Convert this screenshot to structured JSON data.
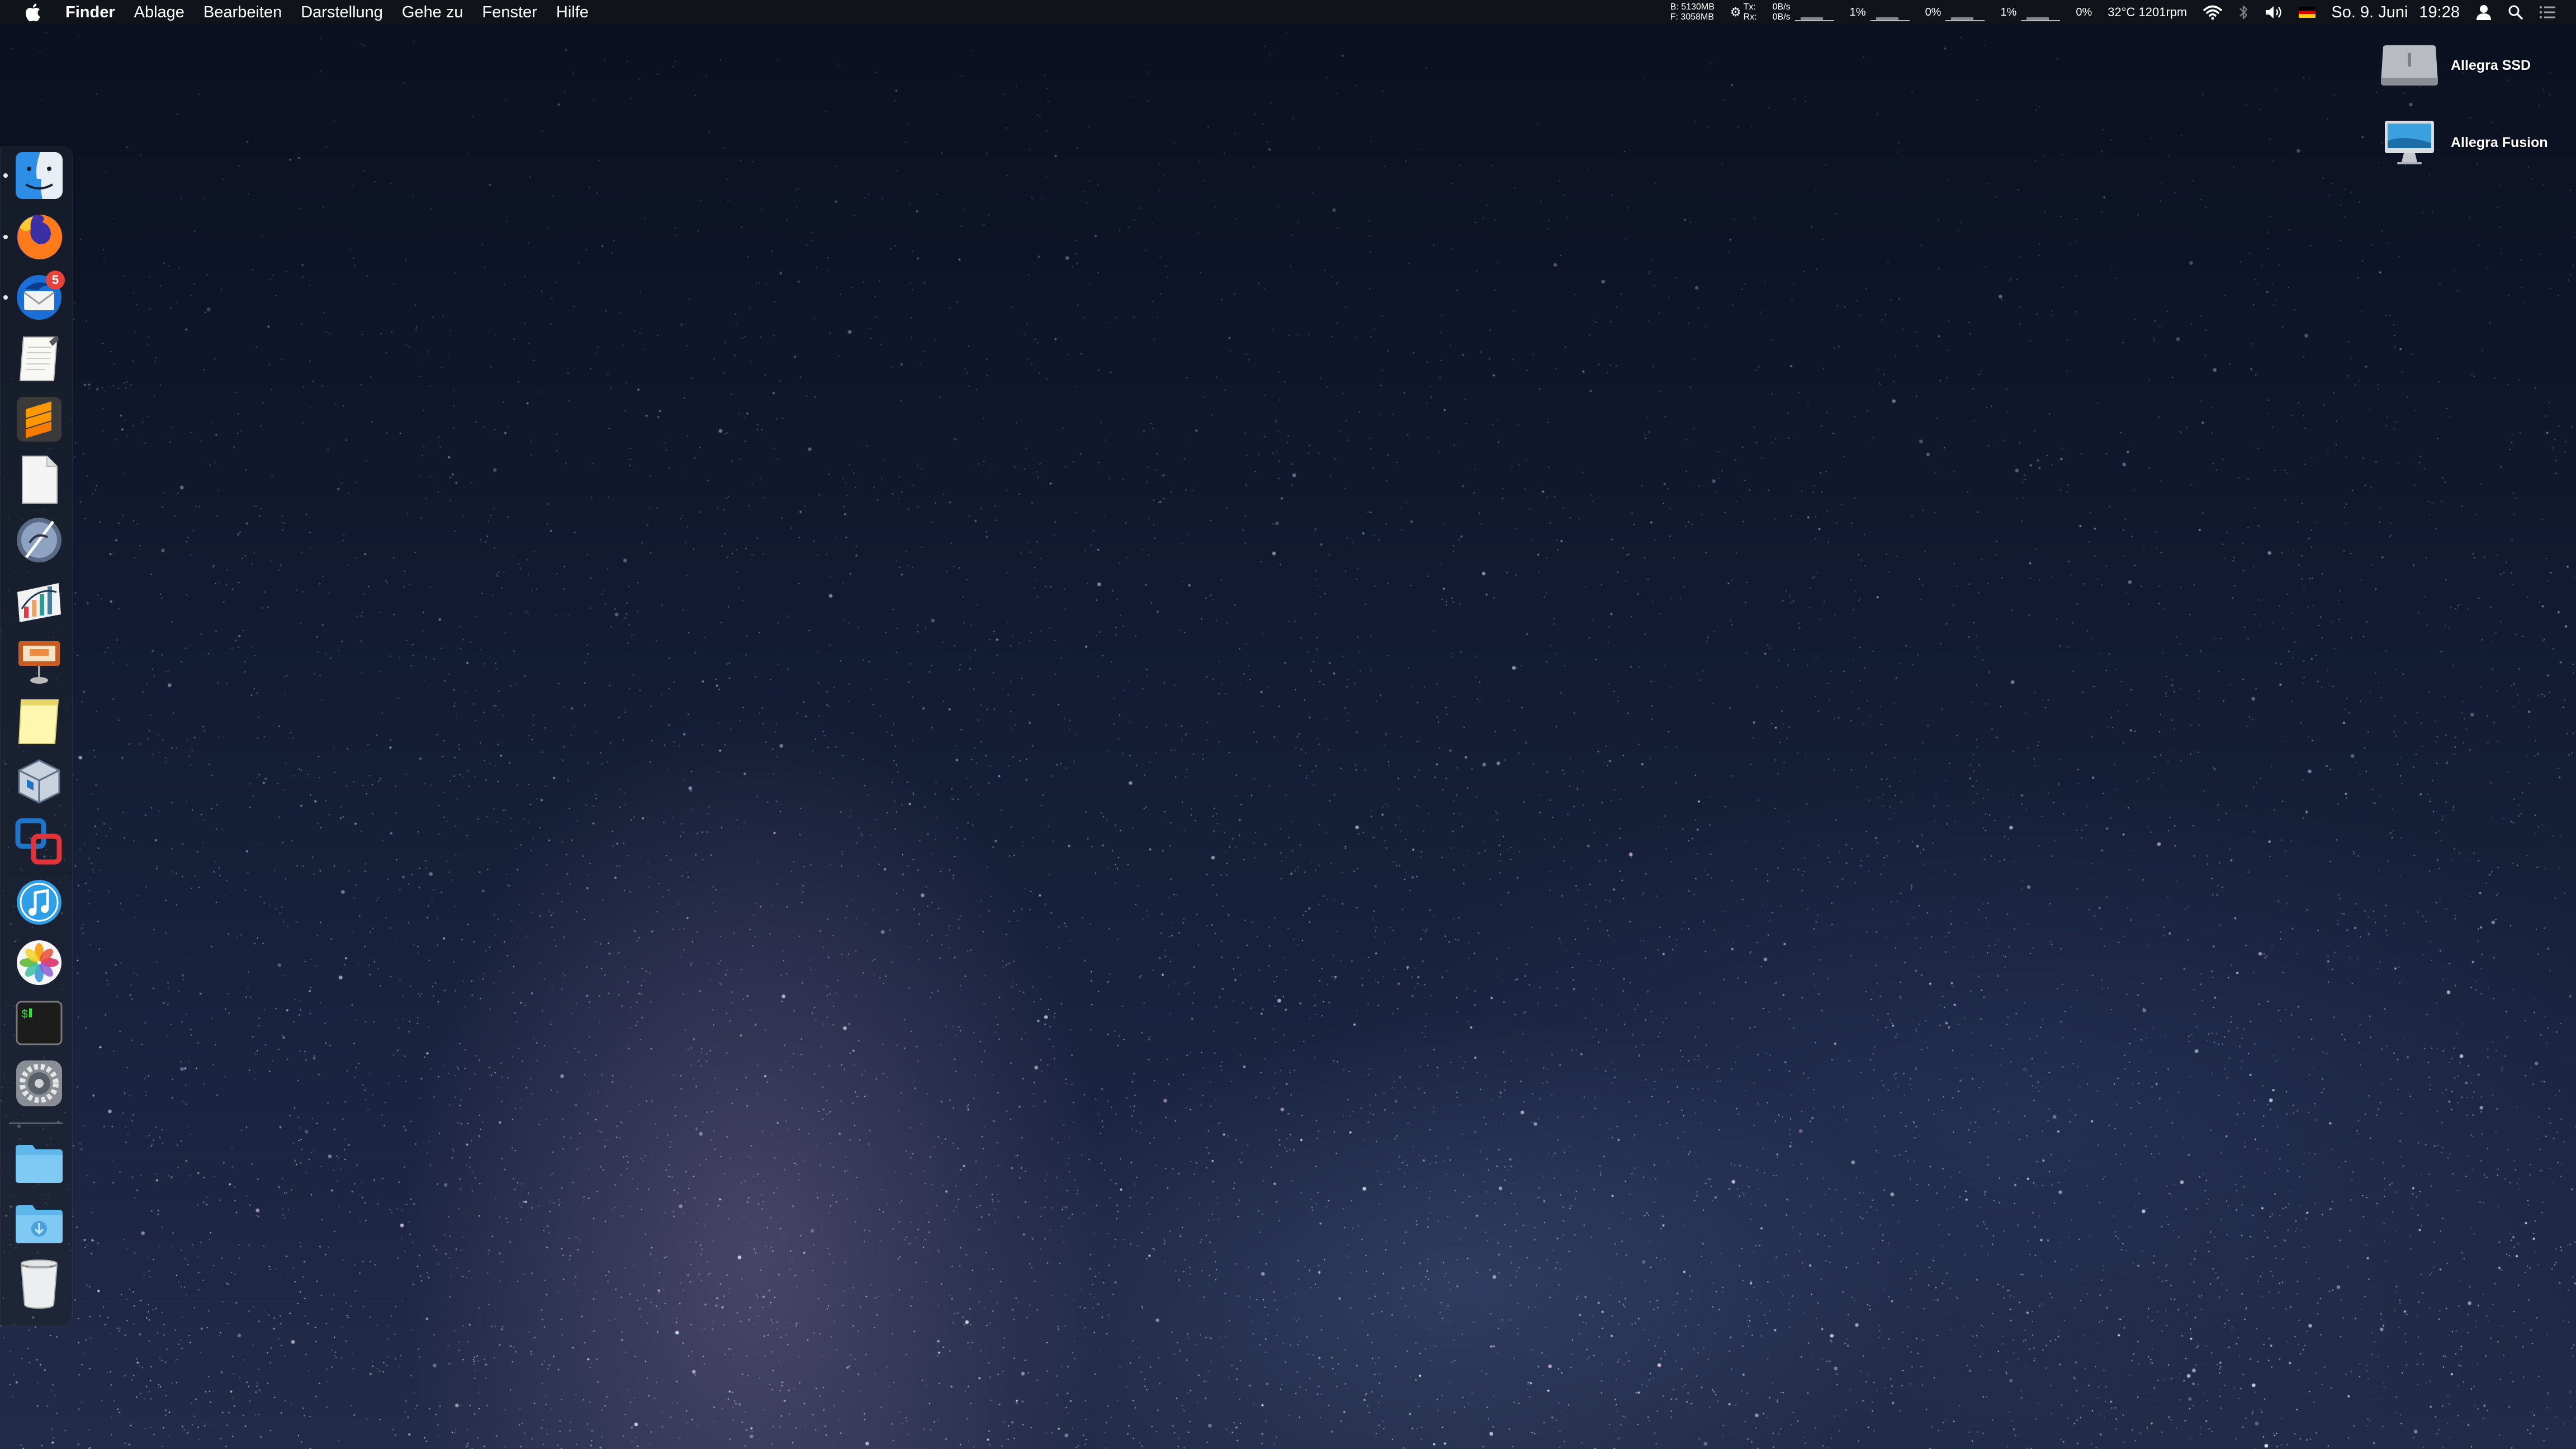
{
  "menubar": {
    "apple_icon": "apple-logo-icon",
    "app_name": "Finder",
    "menus": [
      "Ablage",
      "Bearbeiten",
      "Darstellung",
      "Gehe zu",
      "Fenster",
      "Hilfe"
    ],
    "memory": {
      "line1": "B: 5130MB",
      "line2": "F: 3058MB"
    },
    "network": {
      "tx_label": "Tx:",
      "rx_label": "Rx:",
      "tx_rate": "0B/s",
      "rx_rate": "0B/s"
    },
    "cpu1": "1%",
    "cpu2": "0%",
    "cpu3": "1%",
    "cpu4": "0%",
    "sensors": "32°C 1201rpm",
    "date": "So. 9. Juni",
    "time": "19:28",
    "status_icons": [
      "wifi-icon",
      "bluetooth-icon",
      "volume-icon",
      "flag-de-icon",
      "user-icon",
      "spotlight-icon",
      "notification-center-icon"
    ]
  },
  "dock": {
    "apps": [
      {
        "name": "Finder",
        "icon": "finder-icon",
        "running": true
      },
      {
        "name": "Firefox",
        "icon": "firefox-icon",
        "running": true
      },
      {
        "name": "Thunderbird",
        "icon": "thunderbird-icon",
        "running": true,
        "badge": "5"
      },
      {
        "name": "TextEdit",
        "icon": "textedit-icon",
        "running": false
      },
      {
        "name": "Sublime Text",
        "icon": "sublime-text-icon",
        "running": false
      },
      {
        "name": "Blank Document",
        "icon": "document-icon",
        "running": false
      },
      {
        "name": "Script Editor",
        "icon": "script-editor-icon",
        "running": false
      },
      {
        "name": "Grapher",
        "icon": "grapher-icon",
        "running": false
      },
      {
        "name": "Keynote",
        "icon": "keynote-icon",
        "running": false
      },
      {
        "name": "Notes",
        "icon": "notes-icon",
        "running": false
      },
      {
        "name": "VirtualBox",
        "icon": "virtualbox-icon",
        "running": false
      },
      {
        "name": "VMware Fusion",
        "icon": "vmware-fusion-icon",
        "running": false
      },
      {
        "name": "iTunes",
        "icon": "itunes-icon",
        "running": false
      },
      {
        "name": "Photos",
        "icon": "photos-icon",
        "running": false
      },
      {
        "name": "Terminal",
        "icon": "terminal-icon",
        "running": false
      },
      {
        "name": "System Preferences",
        "icon": "system-preferences-icon",
        "running": false
      }
    ],
    "others": [
      {
        "name": "Applications Folder",
        "icon": "folder-icon"
      },
      {
        "name": "Downloads",
        "icon": "downloads-folder-icon"
      },
      {
        "name": "Trash",
        "icon": "trash-icon"
      }
    ]
  },
  "desktop": {
    "icons": [
      {
        "label": "Allegra SSD",
        "icon": "hard-drive-icon"
      },
      {
        "label": "Allegra Fusion",
        "icon": "imac-drive-icon"
      }
    ]
  },
  "colors": {
    "menubar_bg": "#12141a",
    "badge": "#e8433a",
    "sky_dark": "#0b1020",
    "sky_light": "#222c48"
  }
}
